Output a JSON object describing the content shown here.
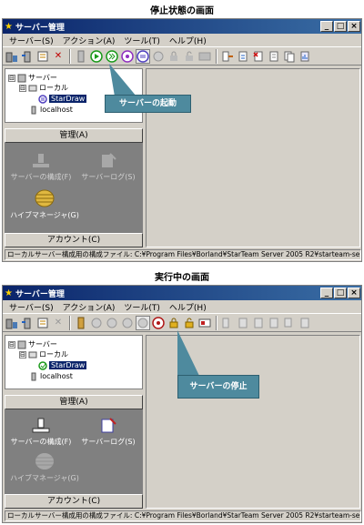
{
  "captions": {
    "top": "停止状態の画面",
    "bottom": "実行中の画面"
  },
  "window": {
    "title": "サーバー管理",
    "menu": [
      "サーバー(S)",
      "アクション(A)",
      "ツール(T)",
      "ヘルプ(H)"
    ],
    "controls": [
      "_",
      "□",
      "×"
    ]
  },
  "tree": {
    "root": "サーバー",
    "local": "ローカル",
    "server": "StarDraw",
    "localhost": "localhost",
    "expand_symbol": "⊟"
  },
  "panel": {
    "manage_tab": "管理(A)",
    "config_label": "サーバーの構成(F)",
    "log_label": "サーバーログ(S)",
    "hive_label": "ハイブマネージャ(G)",
    "account_tab": "アカウント(C)"
  },
  "status_text": "ローカルサーバー構成用の構成ファイル: C:¥Program Files¥Borland¥StarTeam Server 2005 R2¥starteam-ser",
  "callouts": {
    "start": "サーバーの起動",
    "stop": "サーバーの停止"
  },
  "colors": {
    "title_blue": "#0a246a",
    "callout": "#4e8a9e",
    "start_green": "#1a9a1a",
    "stop_red": "#b01818",
    "panel_grey": "#808080"
  }
}
